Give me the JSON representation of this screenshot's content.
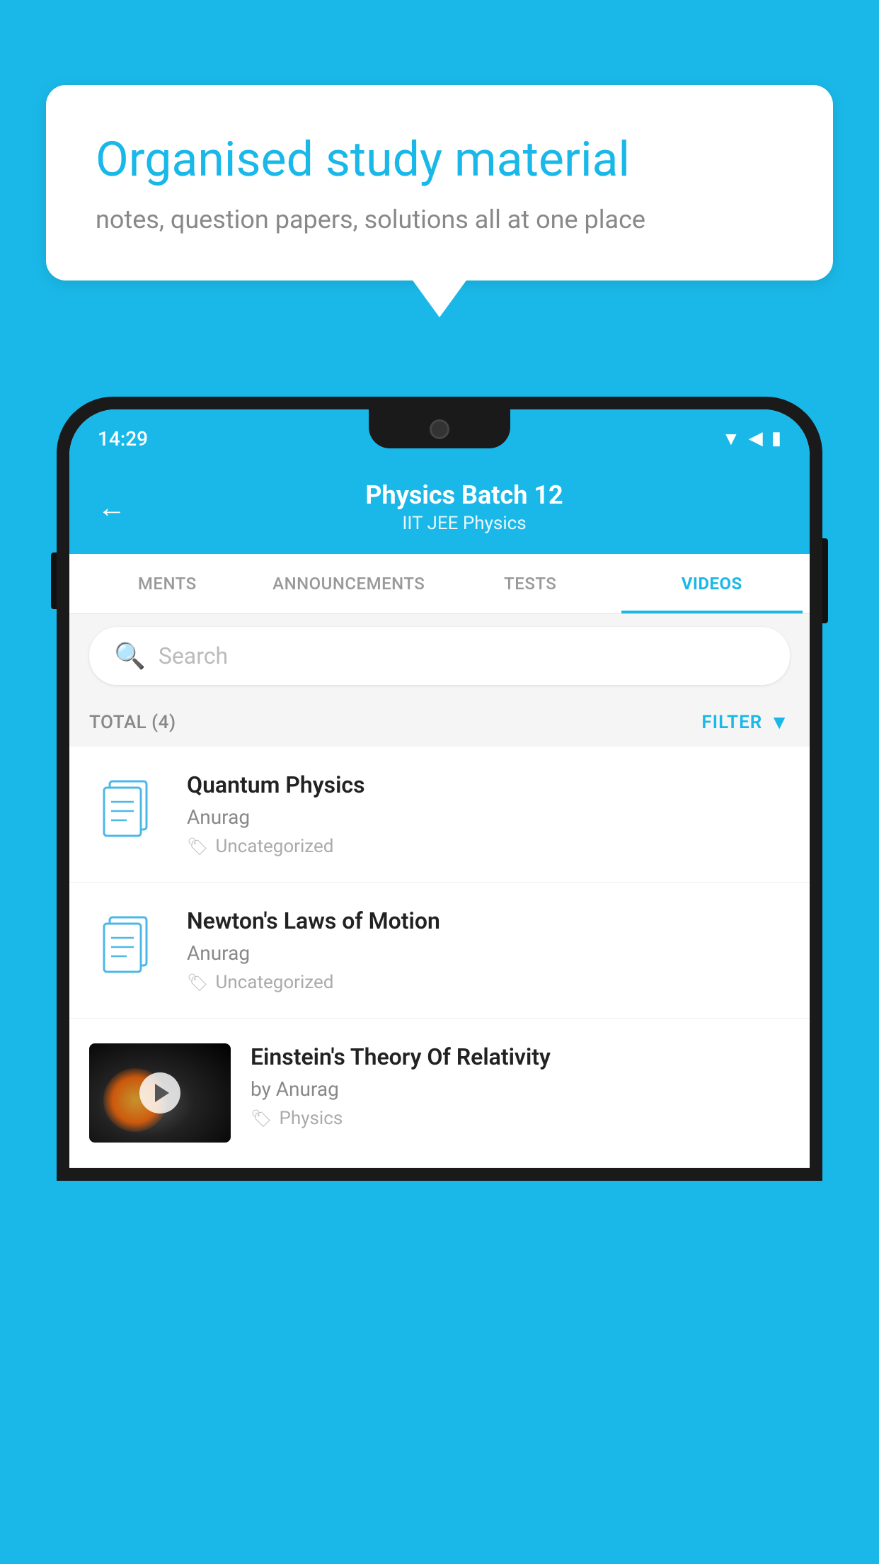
{
  "background_color": "#1ab8e8",
  "hero": {
    "bubble_title": "Organised study material",
    "bubble_subtitle": "notes, question papers, solutions all at one place"
  },
  "phone": {
    "status": {
      "time": "14:29"
    },
    "header": {
      "title": "Physics Batch 12",
      "subtitle": "IIT JEE   Physics",
      "back_label": "←"
    },
    "tabs": [
      {
        "label": "MENTS",
        "active": false
      },
      {
        "label": "ANNOUNCEMENTS",
        "active": false
      },
      {
        "label": "TESTS",
        "active": false
      },
      {
        "label": "VIDEOS",
        "active": true
      }
    ],
    "search": {
      "placeholder": "Search"
    },
    "filter": {
      "total_label": "TOTAL (4)",
      "filter_label": "FILTER"
    },
    "videos": [
      {
        "id": "quantum",
        "title": "Quantum Physics",
        "author": "Anurag",
        "tag": "Uncategorized",
        "type": "doc"
      },
      {
        "id": "newton",
        "title": "Newton's Laws of Motion",
        "author": "Anurag",
        "tag": "Uncategorized",
        "type": "doc"
      },
      {
        "id": "einstein",
        "title": "Einstein's Theory Of Relativity",
        "author": "by Anurag",
        "tag": "Physics",
        "type": "video"
      }
    ]
  }
}
